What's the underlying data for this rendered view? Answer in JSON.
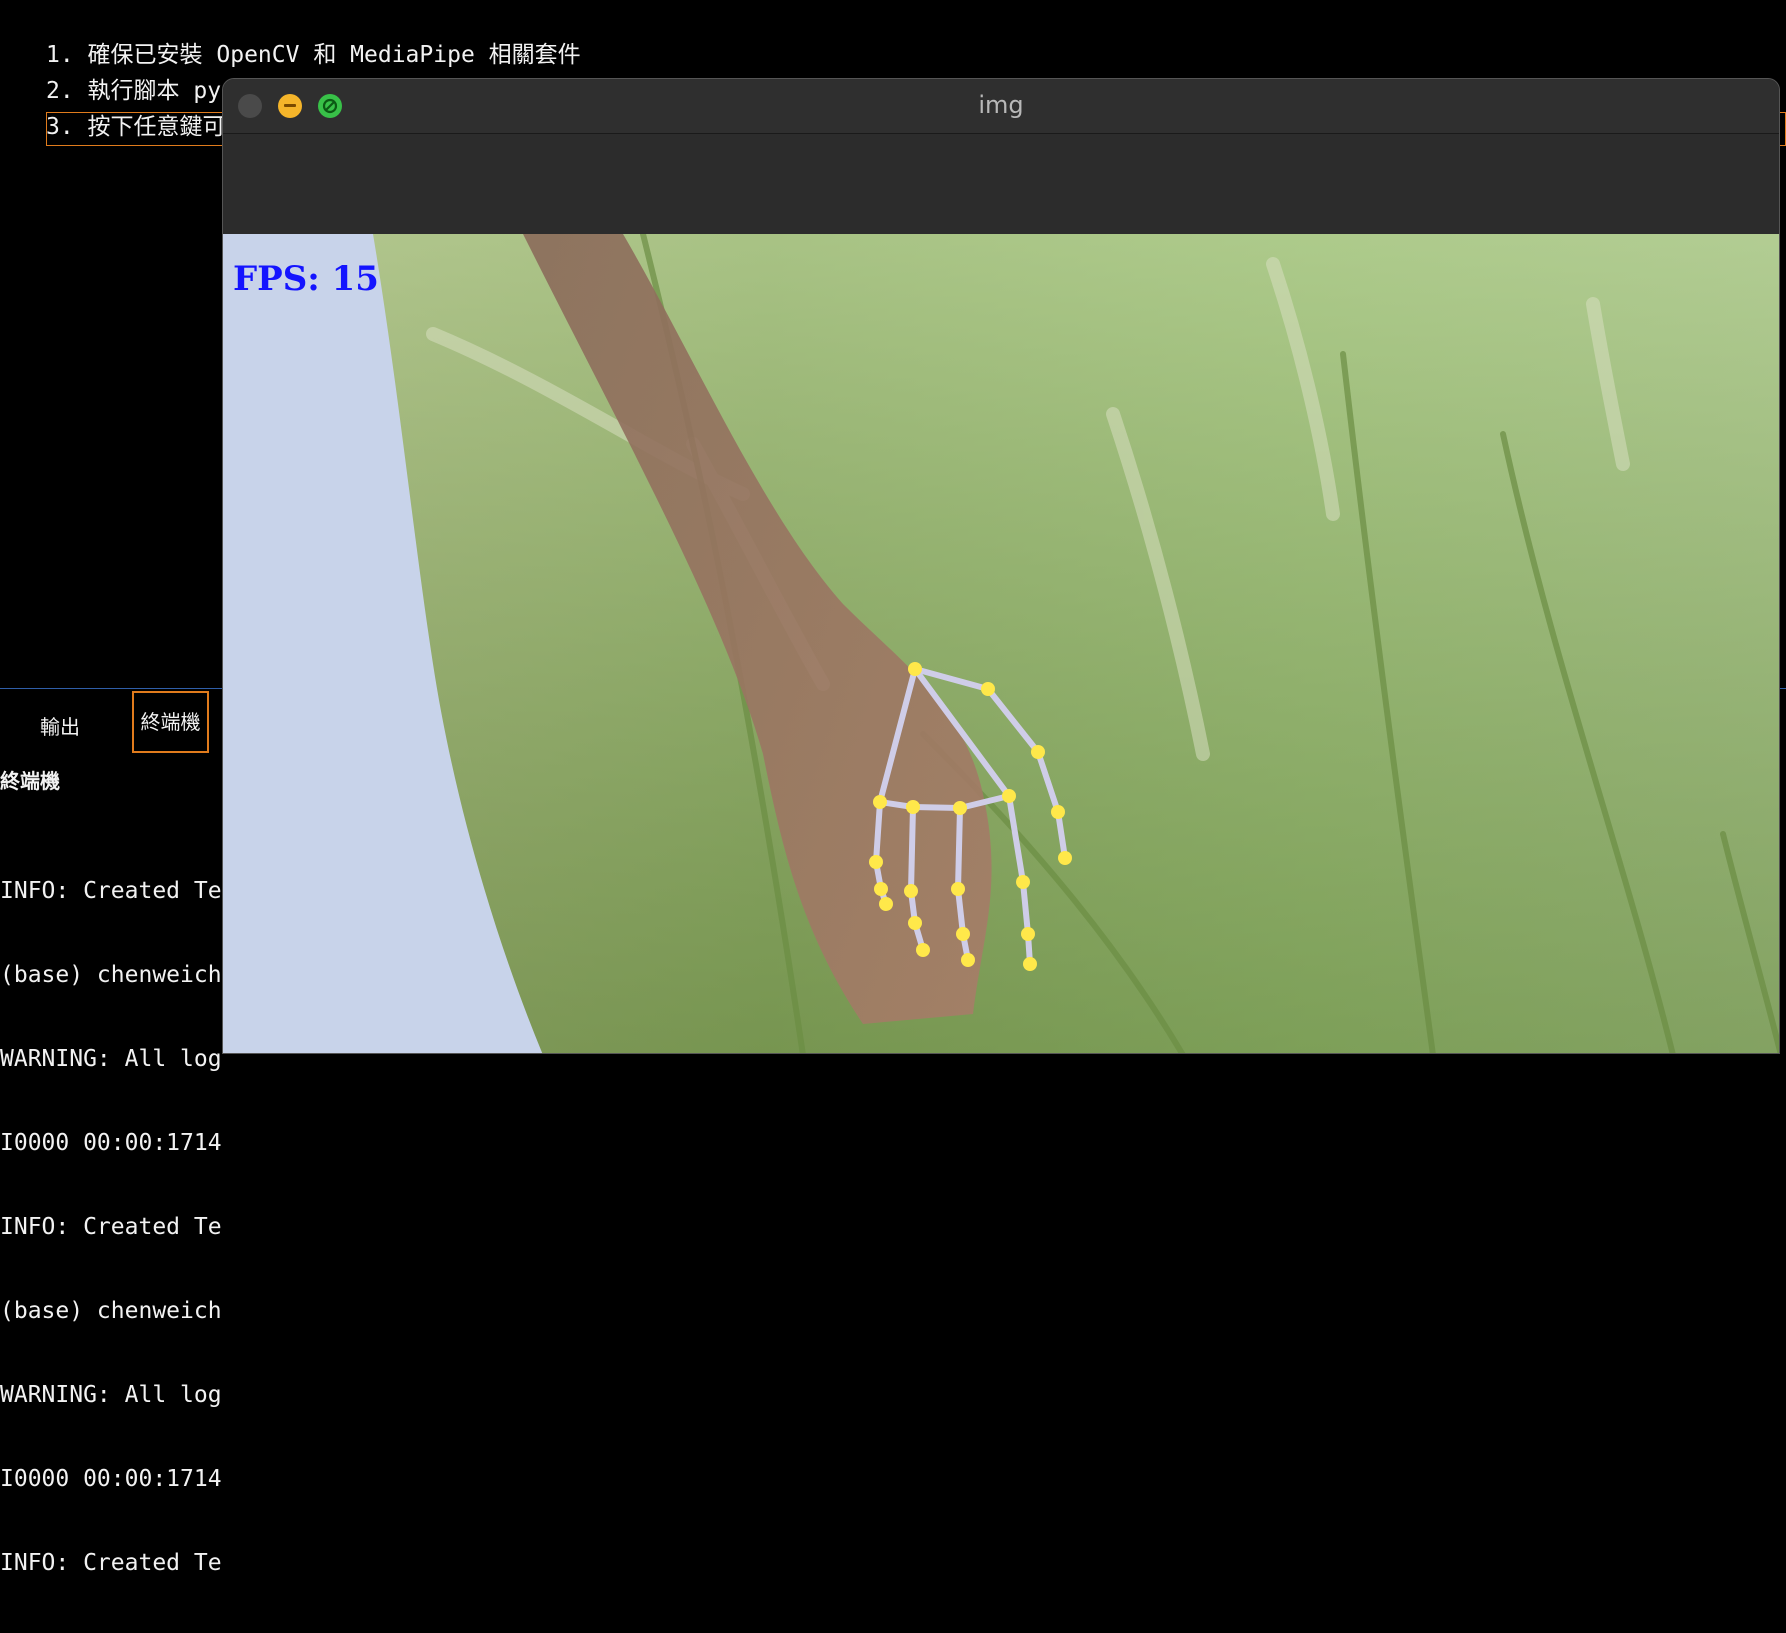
{
  "editor": {
    "lines": [
      "1. 確保已安裝 OpenCV 和 MediaPipe 相關套件",
      "2. 執行腳本 py",
      "3. 按下任意鍵可"
    ]
  },
  "panel": {
    "tabs": [
      {
        "label": "輸出"
      },
      {
        "label": "終端機"
      }
    ],
    "title": "終端機",
    "terminal_lines": [
      "INFO: Created Te",
      "(base) chenweich",
      "WARNING: All log",
      "I0000 00:00:1714",
      "INFO: Created Te",
      "(base) chenweich",
      "WARNING: All log",
      "I0000 00:00:1714",
      "INFO: Created Te"
    ]
  },
  "window": {
    "title": "img",
    "fps_label": "FPS: 15",
    "colors": {
      "fps_text": "#1414ff",
      "landmark": "#ffe84a",
      "connection": "#cfcde8"
    }
  }
}
